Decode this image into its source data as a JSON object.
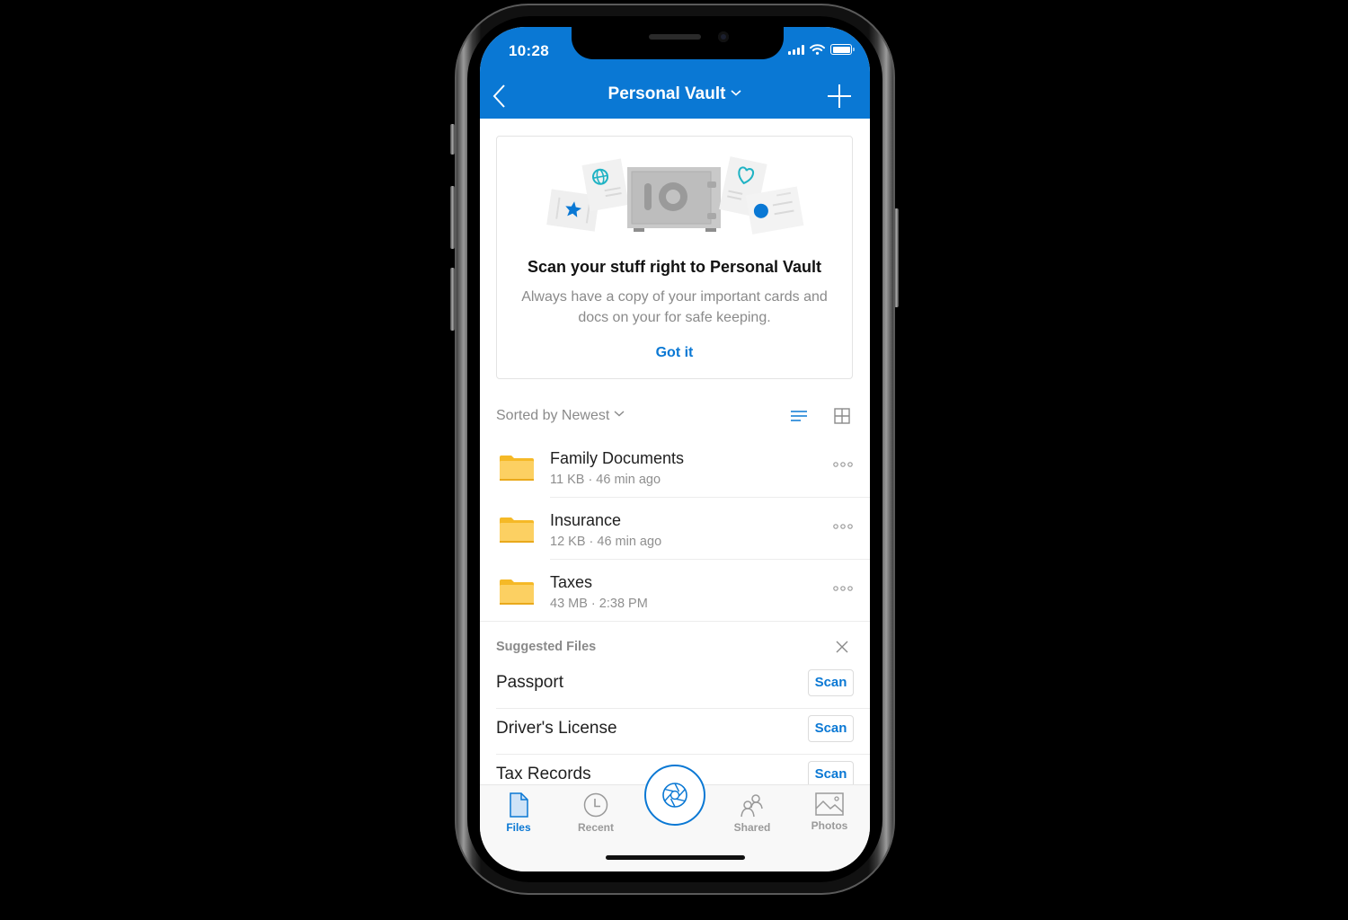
{
  "status_bar": {
    "time": "10:28",
    "signal_bars": 4,
    "wifi": true,
    "battery_level": 1.0
  },
  "nav": {
    "back_icon": "chevron-left-icon",
    "title": "Personal Vault",
    "title_dropdown_icon": "chevron-down-icon",
    "add_icon": "plus-icon"
  },
  "promo_card": {
    "illustration": "vault-safe-with-documents",
    "title": "Scan your stuff right to Personal Vault",
    "body": "Always have a copy of your important cards and docs on your for safe keeping.",
    "action": "Got it"
  },
  "sort": {
    "label": "Sorted by Newest",
    "list_view_icon": "list-view-icon",
    "grid_view_icon": "grid-view-icon",
    "active_view": "list"
  },
  "folders": [
    {
      "name": "Family Documents",
      "meta": "11 KB · 46 min ago"
    },
    {
      "name": "Insurance",
      "meta": "12 KB · 46 min ago"
    },
    {
      "name": "Taxes",
      "meta": "43 MB · 2:38 PM"
    }
  ],
  "suggested": {
    "header": "Suggested Files",
    "items": [
      {
        "name": "Passport",
        "action": "Scan"
      },
      {
        "name": "Driver's License",
        "action": "Scan"
      },
      {
        "name": "Tax Records",
        "action": "Scan"
      }
    ]
  },
  "tabs": [
    {
      "label": "Files",
      "icon": "file-icon",
      "active": true
    },
    {
      "label": "Recent",
      "icon": "clock-icon",
      "active": false
    },
    {
      "label": "Shared",
      "icon": "people-icon",
      "active": false
    },
    {
      "label": "Photos",
      "icon": "image-icon",
      "active": false
    }
  ],
  "camera_button": {
    "icon": "camera-shutter-icon"
  },
  "colors": {
    "accent": "#0a78d4",
    "folder": "#fcd062",
    "folder_tab": "#f5b927",
    "text_secondary": "#8a8a8a"
  }
}
